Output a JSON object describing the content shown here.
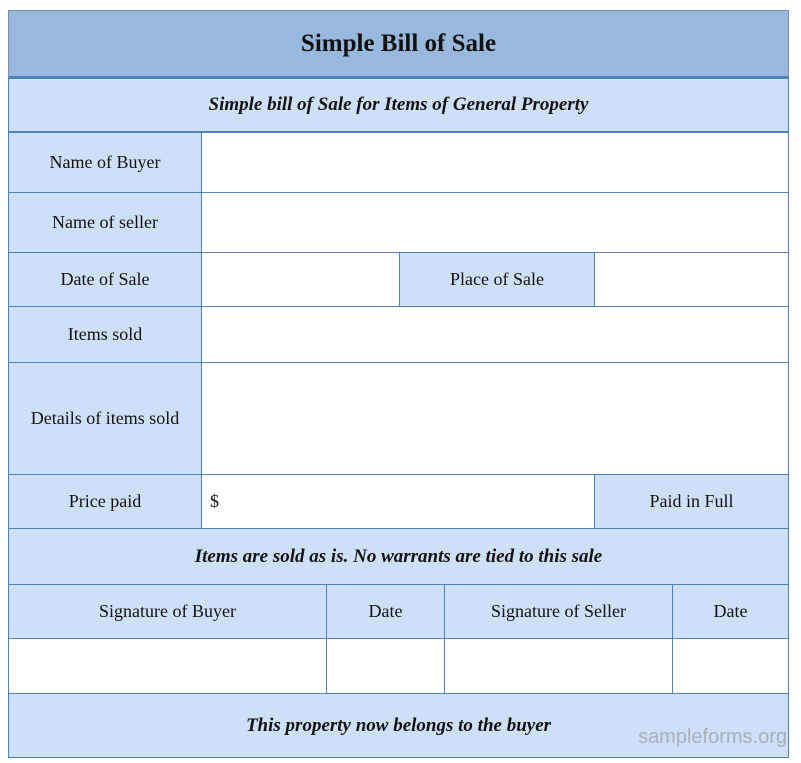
{
  "form": {
    "title": "Simple Bill of Sale",
    "subtitle": "Simple bill of Sale for Items of General Property",
    "fields": {
      "buyer_name_label": "Name of Buyer",
      "seller_name_label": "Name of seller",
      "date_of_sale_label": "Date of Sale",
      "place_of_sale_label": "Place of Sale",
      "items_sold_label": "Items sold",
      "details_label": "Details of items sold",
      "price_paid_label": "Price paid",
      "price_currency": "$",
      "paid_in_full_label": "Paid in Full"
    },
    "notice": "Items are sold as is. No warrants are tied to this sale",
    "signatures": {
      "buyer_signature_label": "Signature of Buyer",
      "buyer_date_label": "Date",
      "seller_signature_label": "Signature of Seller",
      "seller_date_label": "Date"
    },
    "footer": "This property now belongs to the buyer"
  },
  "watermark": "sampleforms.org"
}
